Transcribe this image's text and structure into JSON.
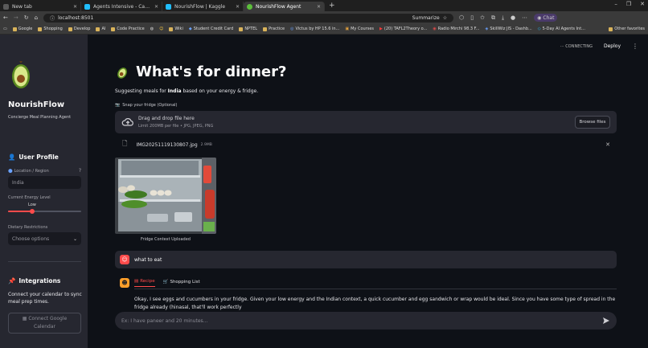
{
  "browser": {
    "tabs": [
      {
        "label": "New tab",
        "color": "#5a5a5a"
      },
      {
        "label": "Agents Intensive - Capstone Proj",
        "color": "#20beff"
      },
      {
        "label": "NourishFlow | Kaggle",
        "color": "#20beff"
      },
      {
        "label": "NourishFlow Agent",
        "color": "#5cbf3b",
        "active": true
      }
    ],
    "url": "localhost:8501",
    "summarize": "Summarize",
    "chat_label": "Chat",
    "bookmarks": [
      "Google",
      "Shopping",
      "Develop",
      "AI",
      "Code Practice",
      "Wiki",
      "Student Credit Card",
      "NPTEL",
      "Practice",
      "Victus by HP 15.6 in...",
      "My Courses",
      "(20) TAFL2Theory o...",
      "Radio Mirchi 98.3 F...",
      "SkillWiz JIS - Dashb...",
      "5-Day AI Agents Int..."
    ],
    "other_bookmarks": "Other favorites"
  },
  "sidebar": {
    "title": "NourishFlow",
    "subtitle": "Concierge Meal Planning Agent",
    "profile_heading": "User Profile",
    "location_label": "Location / Region",
    "location_value": "India",
    "energy_label": "Current Energy Level",
    "energy_value": "Low",
    "energy_fraction": 0.33,
    "dietary_label": "Dietary Restrictions",
    "dietary_placeholder": "Choose options",
    "integrations_heading": "Integrations",
    "integrations_text": "Connect your calendar to sync meal prep times.",
    "gcal_button": "Connect Google Calendar"
  },
  "header": {
    "status": "CONNECTING",
    "deploy": "Deploy"
  },
  "main": {
    "title": "What's for dinner?",
    "subtitle_prefix": "Suggesting meals for ",
    "subtitle_region": "India",
    "subtitle_suffix": " based on your energy & fridge.",
    "upload_label": "Snap your fridge (Optional)",
    "dropzone_title": "Drag and drop file here",
    "dropzone_limit": "Limit 200MB per file • JPG, JPEG, PNG",
    "browse_button": "Browse files",
    "file_name": "IMG20251119130807.jpg",
    "file_size": "2.9MB",
    "image_caption": "Fridge Context Uploaded",
    "user_message": "what to eat",
    "tab_recipe": "Recipe",
    "tab_shopping": "Shopping List",
    "answer": "Okay, I see eggs and cucumbers in your fridge. Given your low energy and the Indian context, a quick cucumber and egg sandwich or wrap would be ideal. Since you have some type of spread in the fridge already (hinasal, that'll work perfectly",
    "chat_placeholder": "Ex: I have paneer and 20 minutes..."
  },
  "colors": {
    "accent": "#ff4b4b",
    "sidebar_bg": "#262730",
    "main_bg": "#0e1117",
    "bot_avatar": "#ff9f2a"
  }
}
